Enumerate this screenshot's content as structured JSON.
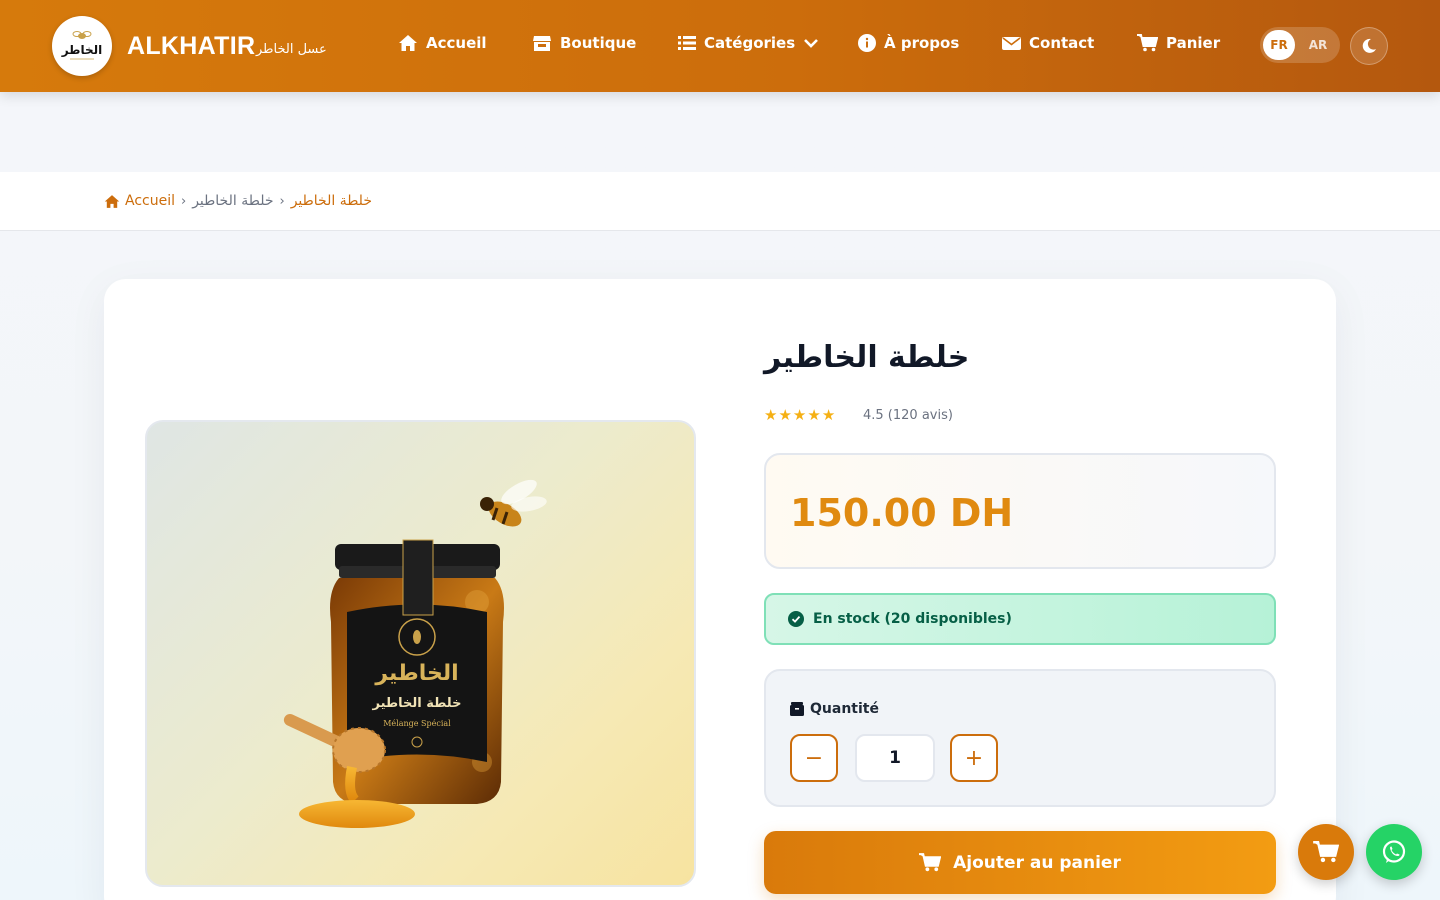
{
  "header": {
    "brand": "ALKHATIR",
    "brand_ar": "عسل الخاطر",
    "logo_text": "الخاطر",
    "nav": [
      {
        "label": "Accueil",
        "icon": "home-icon"
      },
      {
        "label": "Boutique",
        "icon": "store-icon"
      },
      {
        "label": "Catégories",
        "icon": "list-icon"
      },
      {
        "label": "À propos",
        "icon": "info-icon"
      },
      {
        "label": "Contact",
        "icon": "envelope-icon"
      },
      {
        "label": "Panier",
        "icon": "cart-icon"
      }
    ],
    "lang_fr": "FR",
    "lang_ar": "AR"
  },
  "breadcrumb": {
    "home": "Accueil",
    "middle": "خلطة الخاطير",
    "current": "خلطة الخاطير"
  },
  "product": {
    "title": "خلطة الخاطير",
    "rating_text": "4.5 (120 avis)",
    "stars_filled": 5,
    "price": "150.00 DH",
    "stock": "En stock (20 disponibles)",
    "quantity_label": "Quantité",
    "quantity": "1",
    "minus": "−",
    "plus": "+",
    "add_to_cart": "Ajouter au panier",
    "jar_brand": "الخاطير",
    "jar_name": "خلطة الخاطير",
    "jar_sub": "Mélange Spécial"
  },
  "colors": {
    "primary": "#d97a0b",
    "stock_green": "#065f46",
    "whatsapp": "#25d366"
  }
}
